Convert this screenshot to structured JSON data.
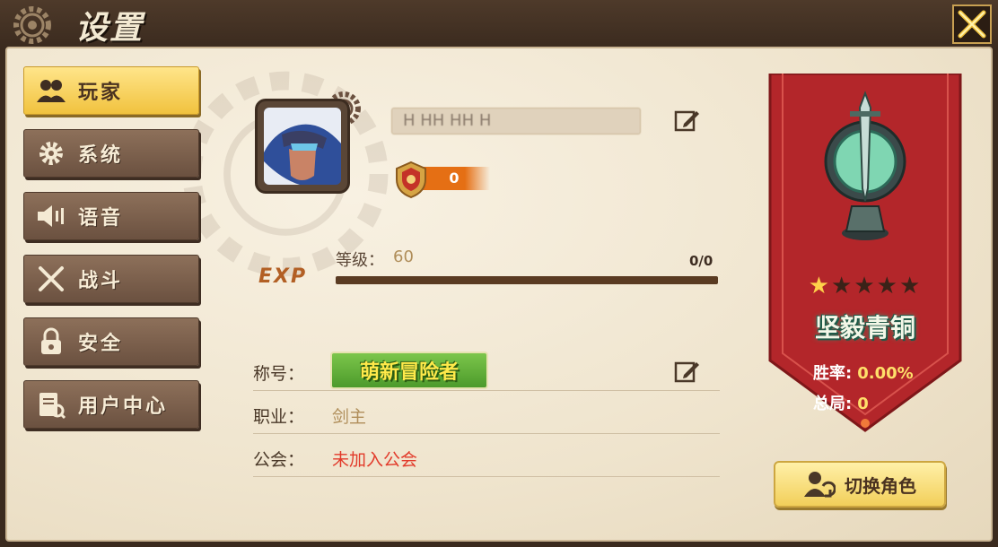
{
  "window": {
    "title": "设置"
  },
  "sidebar": {
    "items": [
      {
        "label": "玩家",
        "icon": "players-icon",
        "active": true
      },
      {
        "label": "系统",
        "icon": "gear-icon",
        "active": false
      },
      {
        "label": "语音",
        "icon": "speaker-icon",
        "active": false
      },
      {
        "label": "战斗",
        "icon": "crossed-swords-icon",
        "active": false
      },
      {
        "label": "安全",
        "icon": "lock-icon",
        "active": false
      },
      {
        "label": "用户中心",
        "icon": "user-center-icon",
        "active": false
      }
    ]
  },
  "profile": {
    "player_name": "Н НН НН Н",
    "rank_points": "0",
    "exp_label": "EXP",
    "level_label": "等级：",
    "level_value": "60",
    "exp_count": "0/0",
    "exp_progress": 0,
    "title_key": "称号：",
    "title_badge": "萌新冒险者",
    "job_key": "职业：",
    "job_value": "剑主",
    "guild_key": "公会：",
    "guild_value": "未加入公会"
  },
  "rank_banner": {
    "stars_total": 5,
    "stars_filled": 1,
    "rank_name": "坚毅青铜",
    "win_rate_label": "胜率:",
    "win_rate_value": "0.00%",
    "total_games_label": "总局:",
    "total_games_value": "0"
  },
  "actions": {
    "switch_role": "切换角色"
  },
  "colors": {
    "accent_gold": "#f1c23e",
    "banner_red": "#b3262a",
    "guild_value": "#e23a2a",
    "job_value": "#b08e5a"
  }
}
